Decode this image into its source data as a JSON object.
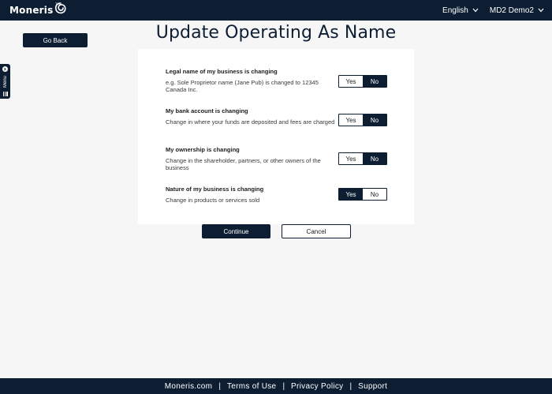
{
  "header": {
    "logo_text": "Moneris",
    "logo_tm": "TM",
    "language": "English",
    "account": "MD2 Demo2"
  },
  "sidebar": {
    "go_back": "Go Back",
    "menu_label": "Menu"
  },
  "main": {
    "title": "Update Operating As Name",
    "questions": [
      {
        "title": "Legal name of my business is changing",
        "description": "e.g. Sole Proprietor name (Jane Pub) is changed to 12345 Canada Inc.",
        "yes": "Yes",
        "no": "No",
        "selected": "No"
      },
      {
        "title": "My bank account is changing",
        "description": "Change in where your funds are deposited and fees are charged",
        "yes": "Yes",
        "no": "No",
        "selected": "No"
      },
      {
        "title": "My ownership is changing",
        "description": "Change in the shareholder, partners, or other owners of the business",
        "yes": "Yes",
        "no": "No",
        "selected": "No"
      },
      {
        "title": "Nature of my business is changing",
        "description": "Change in products or services sold",
        "yes": "Yes",
        "no": "No",
        "selected": "Yes"
      }
    ],
    "continue_label": "Continue",
    "cancel_label": "Cancel"
  },
  "footer": {
    "links": [
      "Moneris.com",
      "Terms of Use",
      "Privacy Policy",
      "Support"
    ],
    "separator": "|"
  },
  "colors": {
    "navy": "#0d1e33",
    "background": "#f6f6f6",
    "card": "#ffffff"
  },
  "icons": [
    "moneris-swirl-logo",
    "chevron-down-icon",
    "info-icon",
    "hamburger-icon"
  ]
}
